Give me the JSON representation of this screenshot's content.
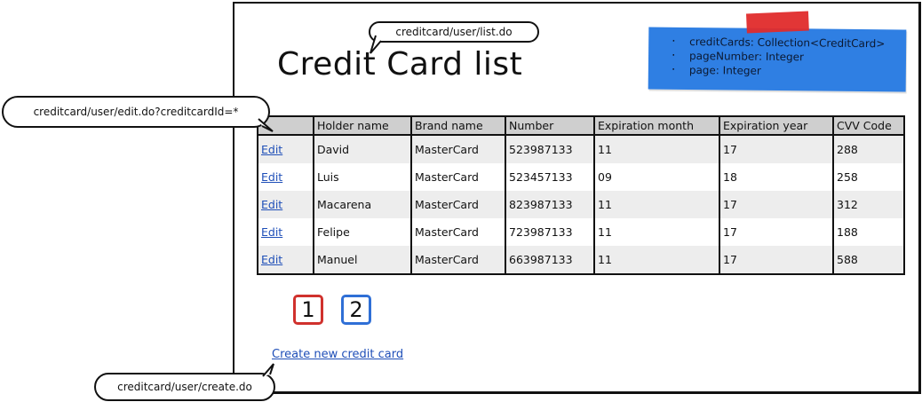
{
  "page": {
    "title": "Credit Card list"
  },
  "annotations": {
    "list_url": "creditcard/user/list.do",
    "edit_url": "creditcard/user/edit.do?creditcardId=*",
    "create_url": "creditcard/user/create.do"
  },
  "note": {
    "items": [
      "creditCards: Collection<CreditCard>",
      "pageNumber: Integer",
      "page: Integer"
    ],
    "color": "#2f7fe3",
    "tape_color": "#e02b2b"
  },
  "table": {
    "columns": [
      "",
      "Holder name",
      "Brand name",
      "Number",
      "Expiration month",
      "Expiration year",
      "CVV Code"
    ],
    "rows": [
      {
        "action": "Edit",
        "holder": "David",
        "brand": "MasterCard",
        "number": "523987133",
        "exp_month": "11",
        "exp_year": "17",
        "cvv": "288"
      },
      {
        "action": "Edit",
        "holder": "Luis",
        "brand": "MasterCard",
        "number": "523457133",
        "exp_month": "09",
        "exp_year": "18",
        "cvv": "258"
      },
      {
        "action": "Edit",
        "holder": "Macarena",
        "brand": "MasterCard",
        "number": "823987133",
        "exp_month": "11",
        "exp_year": "17",
        "cvv": "312"
      },
      {
        "action": "Edit",
        "holder": "Felipe",
        "brand": "MasterCard",
        "number": "723987133",
        "exp_month": "11",
        "exp_year": "17",
        "cvv": "188"
      },
      {
        "action": "Edit",
        "holder": "Manuel",
        "brand": "MasterCard",
        "number": "663987133",
        "exp_month": "11",
        "exp_year": "17",
        "cvv": "588"
      }
    ]
  },
  "pagination": {
    "pages": [
      {
        "label": "1",
        "color": "#d0312d"
      },
      {
        "label": "2",
        "color": "#2f6fd6"
      }
    ]
  },
  "create_link": "Create new credit card"
}
